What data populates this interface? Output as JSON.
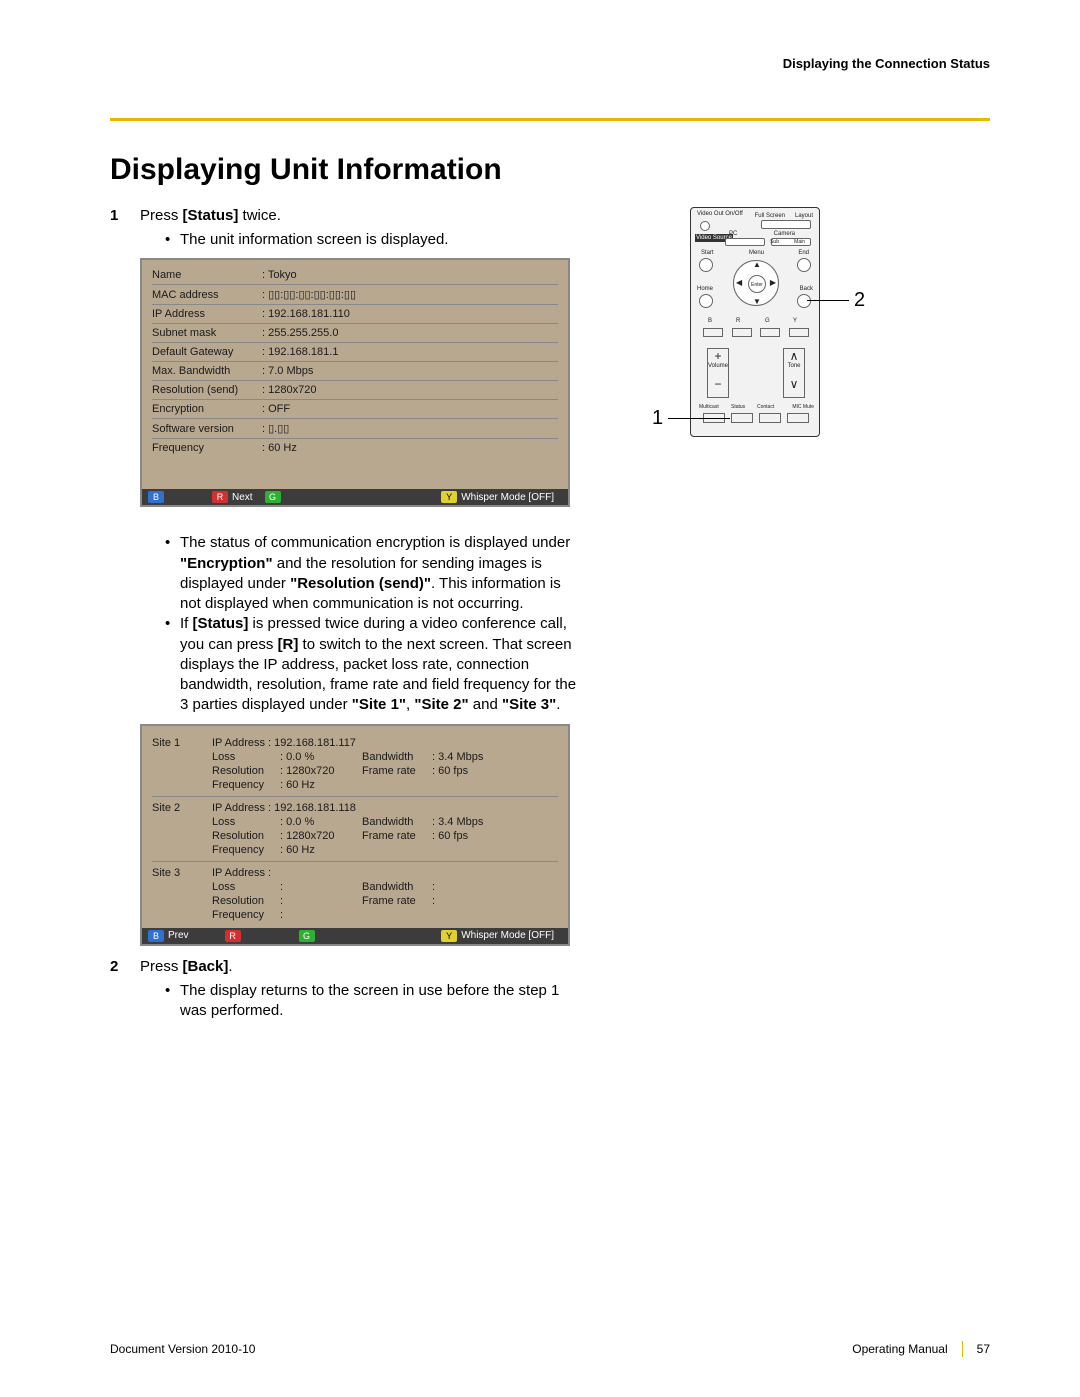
{
  "header": {
    "right": "Displaying the Connection Status"
  },
  "title": "Displaying Unit Information",
  "step1": {
    "num": "1",
    "textParts": [
      "Press ",
      "[Status]",
      " twice."
    ],
    "bullet1": "The unit information screen is displayed."
  },
  "unitInfo": {
    "rows": [
      {
        "label": "Name",
        "value": ": Tokyo"
      },
      {
        "label": "MAC address",
        "value": ": ▯▯:▯▯:▯▯:▯▯:▯▯:▯▯"
      },
      {
        "label": "IP Address",
        "value": ": 192.168.181.110"
      },
      {
        "label": "Subnet mask",
        "value": ": 255.255.255.0"
      },
      {
        "label": "Default Gateway",
        "value": ": 192.168.181.1"
      },
      {
        "label": "Max. Bandwidth",
        "value": ": 7.0 Mbps"
      },
      {
        "label": "Resolution (send)",
        "value": ": 1280x720"
      },
      {
        "label": "Encryption",
        "value": ": OFF"
      },
      {
        "label": "Software version",
        "value": ": ▯.▯▯"
      },
      {
        "label": "Frequency",
        "value": ": 60 Hz"
      }
    ],
    "footer": {
      "b": "B",
      "r": "R",
      "rText": "Next",
      "g": "G",
      "y": "Y",
      "yText": "Whisper Mode [OFF]"
    }
  },
  "notes": {
    "n1Parts": [
      "The status of communication encryption is displayed under ",
      "\"Encryption\"",
      " and the resolution for sending images is displayed under ",
      "\"Resolution (send)\"",
      ". This information is not displayed when communication is not occurring."
    ],
    "n2Parts": [
      "If ",
      "[Status]",
      " is pressed twice during a video conference call, you can press ",
      "[R]",
      " to switch to the next screen. That screen displays the IP address, packet loss rate, connection bandwidth, resolution, frame rate and field frequency for the 3 parties displayed under ",
      "\"Site 1\"",
      ", ",
      "\"Site 2\"",
      " and ",
      "\"Site 3\"",
      "."
    ]
  },
  "siteInfo": {
    "sites": [
      {
        "name": "Site 1",
        "ip": "IP Address : 192.168.181.117",
        "loss": ": 0.0 %",
        "bandwidth": ": 3.4 Mbps",
        "resolution": ": 1280x720",
        "framerate": ": 60 fps",
        "frequency": ": 60 Hz"
      },
      {
        "name": "Site 2",
        "ip": "IP Address : 192.168.181.118",
        "loss": ": 0.0 %",
        "bandwidth": ": 3.4 Mbps",
        "resolution": ": 1280x720",
        "framerate": ": 60 fps",
        "frequency": ": 60 Hz"
      },
      {
        "name": "Site 3",
        "ip": "IP Address :",
        "loss": ":",
        "bandwidth": ":",
        "resolution": ":",
        "framerate": ":",
        "frequency": ":"
      }
    ],
    "labels": {
      "loss": "Loss",
      "bandwidth": "Bandwidth",
      "resolution": "Resolution",
      "framerate": "Frame rate",
      "frequency": "Frequency"
    },
    "footer": {
      "b": "B",
      "bText": "Prev",
      "r": "R",
      "g": "G",
      "y": "Y",
      "yText": "Whisper Mode [OFF]"
    }
  },
  "step2": {
    "num": "2",
    "textParts": [
      "Press ",
      "[Back]",
      "."
    ],
    "bullet1": "The display returns to the screen in use before the step 1 was performed."
  },
  "remote": {
    "labels": {
      "videoOut": "Video Out\nOn/Off",
      "fullScreen": "Full Screen",
      "layout": "Layout",
      "pc": "PC",
      "camera": "Camera",
      "videoSource": "Video\nSource",
      "sub": "Sub",
      "main": "Main",
      "start": "Start",
      "menu": "Menu",
      "end": "End",
      "home": "Home",
      "back": "Back",
      "enter": "Enter",
      "b": "B",
      "r": "R",
      "g": "G",
      "y": "Y",
      "volume": "Volume",
      "tone": "Tone",
      "multicast": "Multicast",
      "status": "Status",
      "contact": "Contact",
      "micMute": "MIC Mute"
    },
    "callout1": "1",
    "callout2": "2"
  },
  "footer": {
    "left": "Document Version  2010-10",
    "rightText": "Operating Manual",
    "pageNum": "57"
  }
}
